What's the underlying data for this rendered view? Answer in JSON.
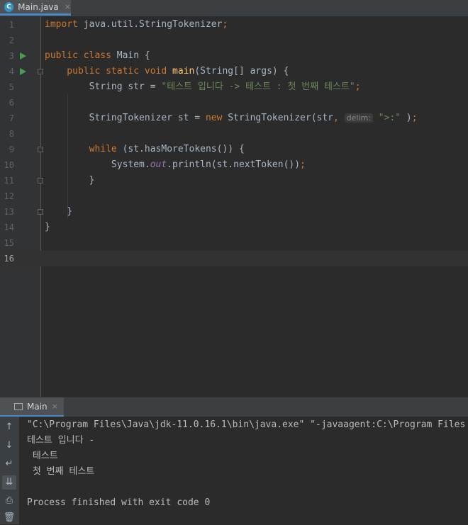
{
  "tab": {
    "file_icon": "C",
    "label": "Main.java",
    "close": "×"
  },
  "editor": {
    "lines": [
      {
        "num": "1",
        "tokens": [
          {
            "t": "import",
            "c": "kw"
          },
          {
            "t": " java.util.StringTokenizer",
            "c": ""
          },
          {
            "t": ";",
            "c": "kw"
          }
        ]
      },
      {
        "num": "2",
        "tokens": []
      },
      {
        "num": "3",
        "tokens": [
          {
            "t": "public class ",
            "c": "kw"
          },
          {
            "t": "Main {",
            "c": ""
          }
        ]
      },
      {
        "num": "4",
        "tokens": [
          {
            "t": "    public static void ",
            "c": "kw"
          },
          {
            "t": "main",
            "c": "fn"
          },
          {
            "t": "(String[] args) {",
            "c": ""
          }
        ]
      },
      {
        "num": "5",
        "tokens": [
          {
            "t": "        String str = ",
            "c": ""
          },
          {
            "t": "\"테스트 입니다 -> 테스트 : 첫 번째 테스트\"",
            "c": "str"
          },
          {
            "t": ";",
            "c": "kw"
          }
        ]
      },
      {
        "num": "6",
        "tokens": []
      },
      {
        "num": "7",
        "tokens": [
          {
            "t": "        StringTokenizer st = ",
            "c": ""
          },
          {
            "t": "new ",
            "c": "kw"
          },
          {
            "t": "StringTokenizer(str",
            "c": ""
          },
          {
            "t": ", ",
            "c": "kw"
          },
          {
            "t": "delim:",
            "c": "hint"
          },
          {
            "t": " ",
            "c": ""
          },
          {
            "t": "\">:\"",
            "c": "str"
          },
          {
            "t": " )",
            "c": ""
          },
          {
            "t": ";",
            "c": "kw"
          }
        ]
      },
      {
        "num": "8",
        "tokens": []
      },
      {
        "num": "9",
        "tokens": [
          {
            "t": "        while ",
            "c": "kw"
          },
          {
            "t": "(st.hasMoreTokens()) {",
            "c": ""
          }
        ]
      },
      {
        "num": "10",
        "tokens": [
          {
            "t": "            System.",
            "c": ""
          },
          {
            "t": "out",
            "c": "fld"
          },
          {
            "t": ".println(st.nextToken())",
            "c": ""
          },
          {
            "t": ";",
            "c": "kw"
          }
        ]
      },
      {
        "num": "11",
        "tokens": [
          {
            "t": "        }",
            "c": ""
          }
        ]
      },
      {
        "num": "12",
        "tokens": []
      },
      {
        "num": "13",
        "tokens": [
          {
            "t": "    }",
            "c": ""
          }
        ]
      },
      {
        "num": "14",
        "tokens": [
          {
            "t": "}",
            "c": ""
          }
        ]
      },
      {
        "num": "15",
        "tokens": []
      },
      {
        "num": "16",
        "tokens": []
      }
    ]
  },
  "run_panel": {
    "tab_label": "Main",
    "close": "×"
  },
  "console": {
    "lines": [
      "\"C:\\Program Files\\Java\\jdk-11.0.16.1\\bin\\java.exe\" \"-javaagent:C:\\Program Files",
      "테스트 입니다 -",
      " 테스트",
      " 첫 번째 테스트",
      "",
      "Process finished with exit code 0"
    ]
  },
  "toolbar_icons": [
    "↑",
    "↓",
    "↵",
    "⇊",
    "⎙",
    "🗑"
  ],
  "colors": {
    "keyword": "#cc7832",
    "string": "#6a8759",
    "function": "#ffc66d",
    "field": "#9876aa",
    "text": "#a9b7c6",
    "run_arrow": "#499c54"
  }
}
